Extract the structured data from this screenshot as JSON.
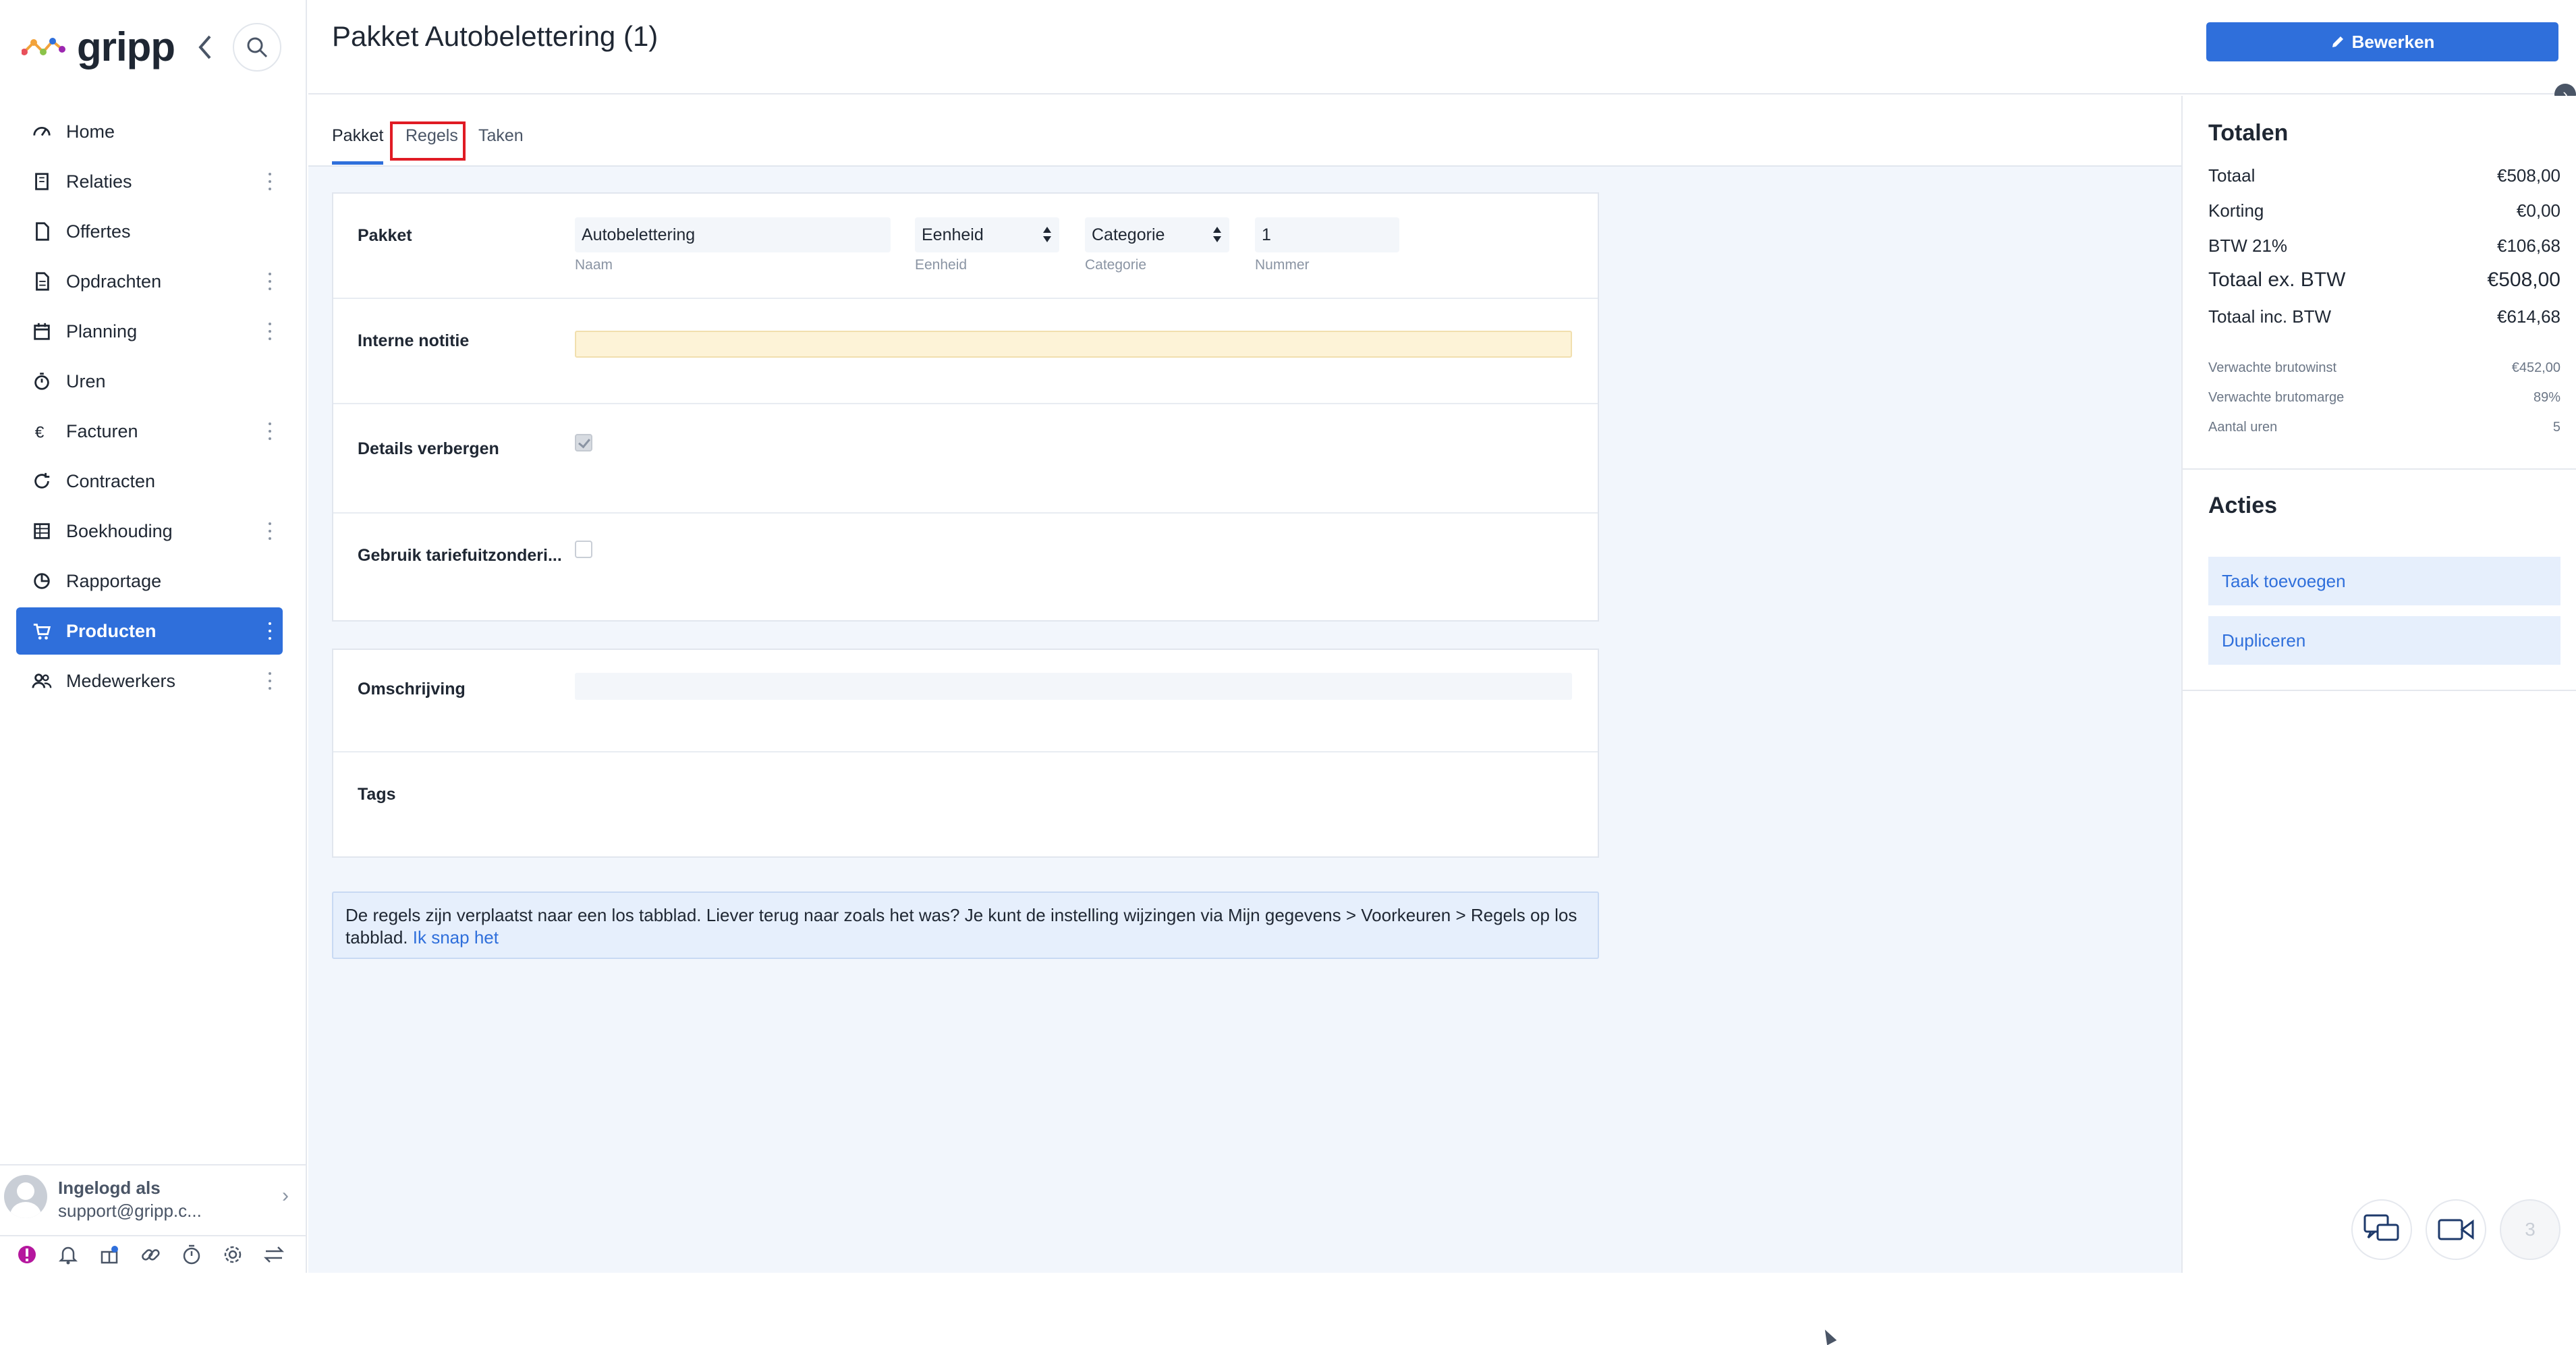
{
  "app": {
    "logo_text": "gripp"
  },
  "sidebar": {
    "items": [
      {
        "label": "Home",
        "icon": "dashboard-icon",
        "more": false
      },
      {
        "label": "Relaties",
        "icon": "building-icon",
        "more": true
      },
      {
        "label": "Offertes",
        "icon": "file-icon",
        "more": false
      },
      {
        "label": "Opdrachten",
        "icon": "document-icon",
        "more": true
      },
      {
        "label": "Planning",
        "icon": "calendar-icon",
        "more": true
      },
      {
        "label": "Uren",
        "icon": "stopwatch-icon",
        "more": false
      },
      {
        "label": "Facturen",
        "icon": "euro-icon",
        "more": true
      },
      {
        "label": "Contracten",
        "icon": "refresh-icon",
        "more": false
      },
      {
        "label": "Boekhouding",
        "icon": "table-icon",
        "more": true
      },
      {
        "label": "Rapportage",
        "icon": "pie-chart-icon",
        "more": false
      },
      {
        "label": "Producten",
        "icon": "cart-icon",
        "more": true,
        "active": true
      },
      {
        "label": "Medewerkers",
        "icon": "users-icon",
        "more": true
      }
    ],
    "user": {
      "label": "Ingelogd als",
      "email": "support@gripp.c..."
    }
  },
  "header": {
    "title": "Pakket Autobelettering (1)",
    "edit_label": "Bewerken"
  },
  "tabs": [
    "Pakket",
    "Regels",
    "Taken"
  ],
  "form": {
    "pakket_label": "Pakket",
    "naam_value": "Autobelettering",
    "naam_sub": "Naam",
    "eenheid_value": "Eenheid",
    "eenheid_sub": "Eenheid",
    "categorie_value": "Categorie",
    "categorie_sub": "Categorie",
    "nummer_value": "1",
    "nummer_sub": "Nummer",
    "interne_notitie_label": "Interne notitie",
    "details_verbergen_label": "Details verbergen",
    "details_verbergen_checked": true,
    "tariefuitzondering_label": "Gebruik tariefuitzonderi...",
    "tariefuitzondering_checked": false,
    "omschrijving_label": "Omschrijving",
    "tags_label": "Tags"
  },
  "notice": {
    "text": "De regels zijn verplaatst naar een los tabblad. Liever terug naar zoals het was? Je kunt de instelling wijzingen via Mijn gegevens > Voorkeuren > Regels op los tabblad.",
    "link": "Ik snap het"
  },
  "totals": {
    "title": "Totalen",
    "rows": [
      {
        "label": "Totaal",
        "value": "€508,00"
      },
      {
        "label": "Korting",
        "value": "€0,00"
      },
      {
        "label": "BTW 21%",
        "value": "€106,68"
      },
      {
        "label": "Totaal ex. BTW",
        "value": "€508,00"
      },
      {
        "label": "Totaal inc. BTW",
        "value": "€614,68"
      }
    ],
    "stats": [
      {
        "label": "Verwachte brutowinst",
        "value": "€452,00"
      },
      {
        "label": "Verwachte brutomarge",
        "value": "89%"
      },
      {
        "label": "Aantal uren",
        "value": "5"
      }
    ]
  },
  "actions": {
    "title": "Acties",
    "items": [
      "Taak toevoegen",
      "Dupliceren"
    ]
  },
  "float": {
    "badge": "3"
  },
  "colors": {
    "accent": "#2f6fdb",
    "highlight": "#e01b24",
    "note_bg": "#fdf3d7"
  }
}
